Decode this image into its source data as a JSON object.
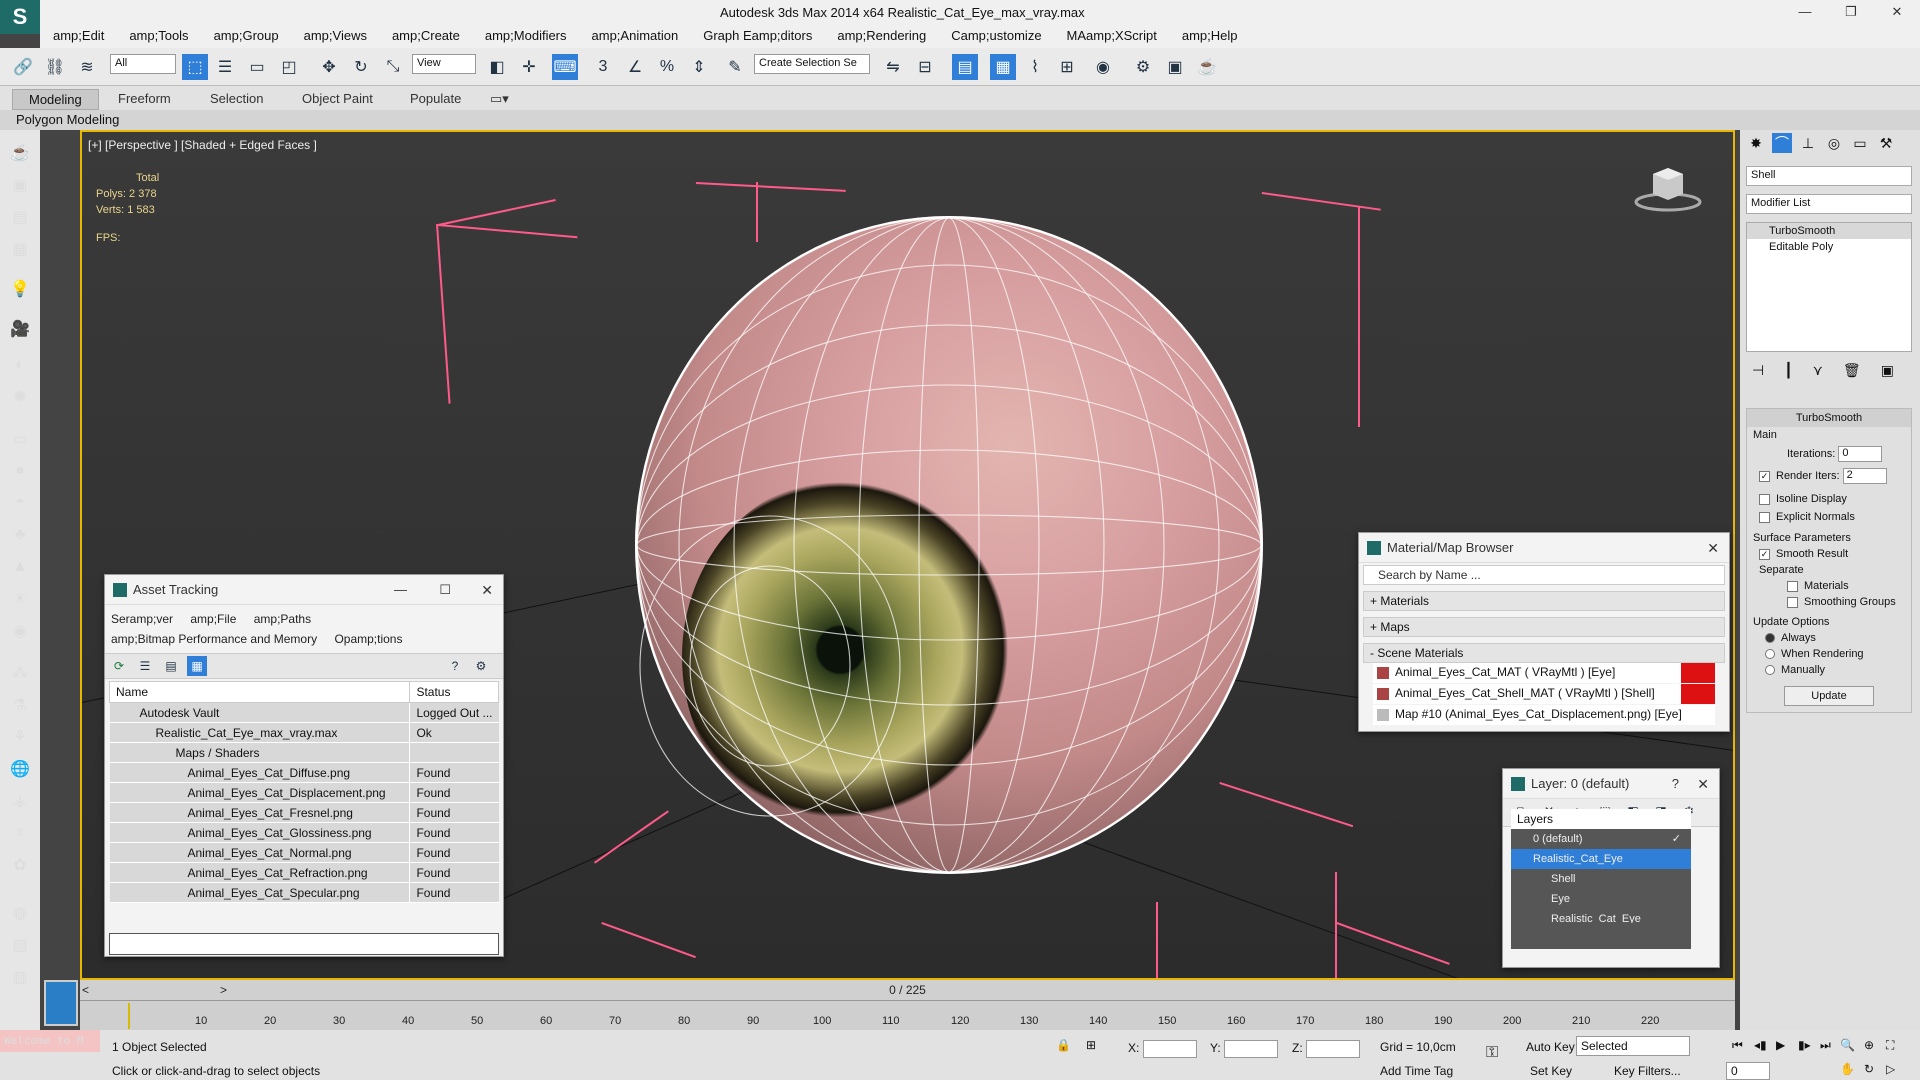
{
  "app": {
    "title": "Autodesk 3ds Max  2014 x64    Realistic_Cat_Eye_max_vray.max"
  },
  "menu": [
    "amp;Edit",
    "amp;Tools",
    "amp;Group",
    "amp;Views",
    "amp;Create",
    "amp;Modifiers",
    "amp;Animation",
    "Graph Eamp;ditors",
    "amp;Rendering",
    "Camp;ustomize",
    "MAamp;XScript",
    "amp;Help"
  ],
  "toolbar": {
    "filter": "All",
    "refcoord": "View",
    "selset": "Create Selection Se"
  },
  "ribbon": {
    "tabs": [
      "Modeling",
      "Freeform",
      "Selection",
      "Object Paint",
      "Populate"
    ],
    "sub": "Polygon Modeling"
  },
  "viewport": {
    "label": "[+] [Perspective ] [Shaded + Edged Faces ]",
    "total": "Total",
    "polys_label": "Polys:",
    "polys": "2 378",
    "verts_label": "Verts:",
    "verts": "1 583",
    "fps": "FPS:"
  },
  "asset": {
    "title": "Asset Tracking",
    "menu": [
      "Seramp;ver",
      "amp;File",
      "amp;Paths",
      "amp;Bitmap Performance and Memory",
      "Opamp;tions"
    ],
    "cols": [
      "Name",
      "Status"
    ],
    "rows": [
      {
        "name": "Autodesk Vault",
        "status": "Logged Out ..."
      },
      {
        "name": "Realistic_Cat_Eye_max_vray.max",
        "status": "Ok"
      },
      {
        "name": "Maps / Shaders",
        "status": ""
      },
      {
        "name": "Animal_Eyes_Cat_Diffuse.png",
        "status": "Found"
      },
      {
        "name": "Animal_Eyes_Cat_Displacement.png",
        "status": "Found"
      },
      {
        "name": "Animal_Eyes_Cat_Fresnel.png",
        "status": "Found"
      },
      {
        "name": "Animal_Eyes_Cat_Glossiness.png",
        "status": "Found"
      },
      {
        "name": "Animal_Eyes_Cat_Normal.png",
        "status": "Found"
      },
      {
        "name": "Animal_Eyes_Cat_Refraction.png",
        "status": "Found"
      },
      {
        "name": "Animal_Eyes_Cat_Specular.png",
        "status": "Found"
      }
    ]
  },
  "matbrowser": {
    "title": "Material/Map Browser",
    "search": "Search by Name ...",
    "groups": [
      "+ Materials",
      "+ Maps",
      "- Scene Materials"
    ],
    "items": [
      "Animal_Eyes_Cat_MAT ( VRayMtl ) [Eye]",
      "Animal_Eyes_Cat_Shell_MAT ( VRayMtl ) [Shell]",
      "Map #10 (Animal_Eyes_Cat_Displacement.png) [Eye]"
    ]
  },
  "layer": {
    "title": "Layer: 0 (default)",
    "header": "Layers",
    "items": [
      "0 (default)",
      "Realistic_Cat_Eye",
      "Shell",
      "Eye",
      "Realistic_Cat_Eye"
    ]
  },
  "cmd": {
    "name": "Shell",
    "modlist": "Modifier List",
    "stack": [
      "TurboSmooth",
      "Editable Poly"
    ],
    "rollout": "TurboSmooth",
    "main": "Main",
    "iterations_label": "Iterations:",
    "iterations": "0",
    "renderiters_label": "Render Iters:",
    "renderiters": "2",
    "isoline": "Isoline Display",
    "explicit": "Explicit Normals",
    "surface": "Surface Parameters",
    "smooth": "Smooth Result",
    "separate": "Separate",
    "materials": "Materials",
    "smoothing": "Smoothing Groups",
    "update_options": "Update Options",
    "always": "Always",
    "when": "When Rendering",
    "manually": "Manually",
    "update": "Update"
  },
  "timeline": {
    "frame": "0 / 225",
    "ticks": [
      "10",
      "20",
      "30",
      "40",
      "50",
      "60",
      "70",
      "80",
      "90",
      "100",
      "110",
      "120",
      "130",
      "140",
      "150",
      "160",
      "170",
      "180",
      "190",
      "200",
      "210",
      "220"
    ]
  },
  "status": {
    "welcome": "Welcome to M",
    "selected": "1 Object Selected",
    "hint": "Click or click-and-drag to select objects",
    "x": "X:",
    "y": "Y:",
    "z": "Z:",
    "grid": "Grid = 10,0cm",
    "autokey": "Auto Key",
    "selset": "Selected",
    "setkey": "Set Key",
    "keyfilters": "Key Filters...",
    "addtime": "Add Time Tag",
    "frame": "0"
  }
}
